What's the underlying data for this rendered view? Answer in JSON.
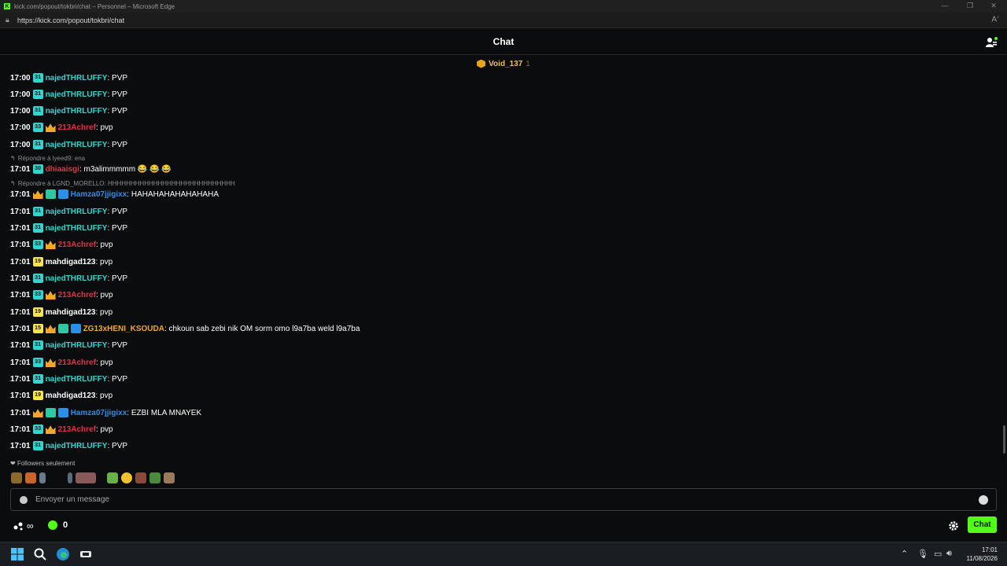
{
  "window": {
    "title": "kick.com/popout/tokbri/chat – Personnel – Microsoft Edge",
    "url": "https://kick.com/popout/tokbri/chat"
  },
  "header": {
    "title": "Chat"
  },
  "pinned": {
    "name": "Void_137",
    "count": "1"
  },
  "messages": [
    {
      "time": "17:00",
      "user": "najedTHRLUFFY",
      "user_color": "#2fd6d0",
      "text": ": PVP"
    },
    {
      "time": "17:00",
      "user": "najedTHRLUFFY",
      "user_color": "#2fd6d0",
      "text": ": PVP"
    },
    {
      "time": "17:00",
      "user": "najedTHRLUFFY",
      "user_color": "#2fd6d0",
      "text": ": PVP"
    },
    {
      "time": "17:00",
      "user": "213Achref",
      "user_color": "#e0344a",
      "text": ": pvp"
    },
    {
      "time": "17:00",
      "user": "najedTHRLUFFY",
      "user_color": "#2fd6d0",
      "text": ": PVP"
    },
    {
      "reply": "Répondre à lyeed9: ena",
      "time": "17:01",
      "user": "dhiaaisgi",
      "user_color": "#e0344a",
      "text": ": m3alimmmmm 😂 😂 😂"
    },
    {
      "reply": "Répondre à LGND_MORELLO: HHHHHHHHHHHHHHHHHHHHHHHHHHHH",
      "time": "17:01",
      "user": "Hamza07jjigixx",
      "user_color": "#2a8fe6",
      "text": ": HAHAHAHAHAHAHAHA"
    },
    {
      "time": "17:01",
      "user": "najedTHRLUFFY",
      "user_color": "#2fd6d0",
      "text": ": PVP"
    },
    {
      "time": "17:01",
      "user": "najedTHRLUFFY",
      "user_color": "#2fd6d0",
      "text": ": PVP"
    },
    {
      "time": "17:01",
      "user": "213Achref",
      "user_color": "#e0344a",
      "text": ": pvp"
    },
    {
      "time": "17:01",
      "user": "mahdigad123",
      "user_color": "#ffffff",
      "text": ": pvp"
    },
    {
      "time": "17:01",
      "user": "najedTHRLUFFY",
      "user_color": "#2fd6d0",
      "text": ": PVP"
    },
    {
      "time": "17:01",
      "user": "213Achref",
      "user_color": "#e0344a",
      "text": ": pvp"
    },
    {
      "time": "17:01",
      "user": "mahdigad123",
      "user_color": "#ffffff",
      "text": ": pvp"
    },
    {
      "time": "17:01",
      "user": "ZG13xHENI_KSOUDA",
      "user_color": "#f4a72a",
      "text": ": chkoun sab zebi nik OM sorm omo l9a7ba weld l9a7ba"
    },
    {
      "time": "17:01",
      "user": "najedTHRLUFFY",
      "user_color": "#2fd6d0",
      "text": ": PVP"
    },
    {
      "time": "17:01",
      "user": "213Achref",
      "user_color": "#e0344a",
      "text": ": pvp"
    },
    {
      "time": "17:01",
      "user": "najedTHRLUFFY",
      "user_color": "#2fd6d0",
      "text": ": PVP"
    },
    {
      "time": "17:01",
      "user": "mahdigad123",
      "user_color": "#ffffff",
      "text": ": pvp"
    },
    {
      "time": "17:01",
      "user": "Hamza07jjigixx",
      "user_color": "#2a8fe6",
      "text": ": EZBI MLA MNAYEK"
    },
    {
      "time": "17:01",
      "user": "213Achref",
      "user_color": "#e0344a",
      "text": ": pvp"
    },
    {
      "time": "17:01",
      "user": "najedTHRLUFFY",
      "user_color": "#2fd6d0",
      "text": ": PVP"
    }
  ],
  "badge_numbers": {
    "najed": "31",
    "achref": "33",
    "mahdi": "19",
    "dhia": "30",
    "zg": "15"
  },
  "followers_only": "Followers seulement",
  "input": {
    "placeholder": "Envoyer un message"
  },
  "footer": {
    "infinity": "∞",
    "points": "0",
    "chat_button": "Chat"
  },
  "taskbar": {
    "time": "17:01",
    "date": "11/08/2026"
  },
  "colors": {
    "accent": "#53fc18",
    "background": "#0b0c0d"
  }
}
